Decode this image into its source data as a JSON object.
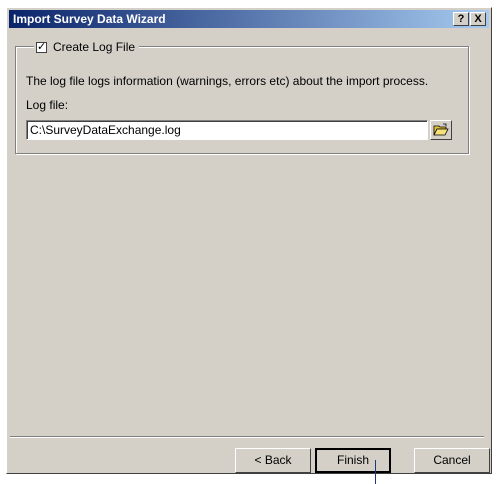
{
  "window": {
    "title": "Import Survey Data Wizard",
    "help_button": "?",
    "close_button": "X"
  },
  "log_group": {
    "checkbox_label": "Create Log File",
    "checked": true,
    "description": "The log file logs information (warnings, errors etc) about the import process.",
    "log_file_label": "Log file:",
    "log_file_value": "C:\\SurveyDataExchange.log",
    "browse_icon": "open-folder-icon"
  },
  "buttons": {
    "back": "< Back",
    "finish": "Finish",
    "cancel": "Cancel"
  },
  "colors": {
    "title_start": "#0a246a",
    "title_end": "#a6caf0",
    "face": "#d4d0c8"
  }
}
